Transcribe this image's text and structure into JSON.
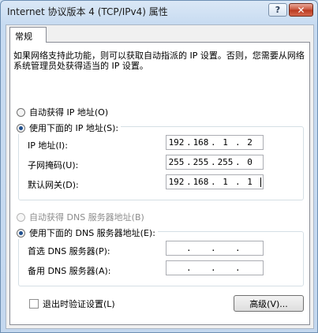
{
  "window": {
    "title": "Internet 协议版本 4 (TCP/IPv4) 属性",
    "help_glyph": "?",
    "close_glyph": "✕"
  },
  "tab": {
    "label": "常规"
  },
  "intro": "如果网络支持此功能，则可以获取自动指派的 IP 设置。否则，您需要从网络系统管理员处获得适当的 IP 设置。",
  "ip_section": {
    "auto_label": "自动获得 IP 地址(O)",
    "manual_label": "使用下面的 IP 地址(S):",
    "fields": [
      {
        "label": "IP 地址(I):",
        "octets": [
          "192",
          "168",
          "1",
          "2"
        ]
      },
      {
        "label": "子网掩码(U):",
        "octets": [
          "255",
          "255",
          "255",
          "0"
        ]
      },
      {
        "label": "默认网关(D):",
        "octets": [
          "192",
          "168",
          "1",
          "1"
        ]
      }
    ]
  },
  "dns_section": {
    "auto_label": "自动获得 DNS 服务器地址(B)",
    "manual_label": "使用下面的 DNS 服务器地址(E):",
    "fields": [
      {
        "label": "首选 DNS 服务器(P):",
        "octets": [
          "",
          "",
          "",
          ""
        ]
      },
      {
        "label": "备用 DNS 服务器(A):",
        "octets": [
          "",
          "",
          "",
          ""
        ]
      }
    ]
  },
  "validate_label": "退出时验证设置(L)",
  "advanced_label": "高级(V)..."
}
